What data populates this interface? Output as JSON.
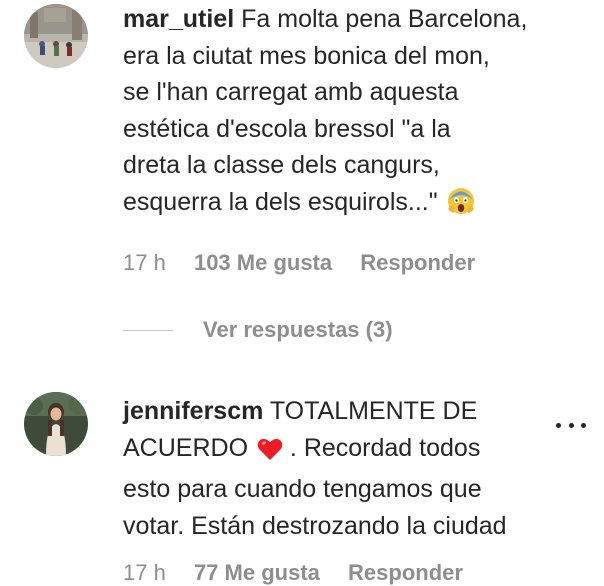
{
  "comments": [
    {
      "username": "mar_utiel",
      "lines": [
        "Fa molta pena Barcelona,",
        "era la ciutat mes bonica del mon,",
        "se l'han carregat amb aquesta",
        "estética d'escola bressol \"a la",
        "dreta la classe dels cangurs,",
        "esquerra la dels esquirols...\""
      ],
      "emoji": "screaming-face-emoji",
      "time": "17 h",
      "likes": "103 Me gusta",
      "reply": "Responder",
      "view_replies": "Ver respuestas (3)"
    },
    {
      "username": "jenniferscm",
      "lines": [
        "TOTALMENTE DE",
        "ACUERDO",
        ". Recordad todos",
        "esto para cuando tengamos que",
        "votar. Están destrozando la ciudad"
      ],
      "emoji": "red-heart-emoji",
      "time": "17 h",
      "likes": "77 Me gusta",
      "reply": "Responder"
    }
  ],
  "icons": {
    "more": "more-options-icon"
  },
  "colors": {
    "text": "#262626",
    "secondary": "#8e8e8e",
    "divider": "#c7c7c7",
    "heart": "#ed1c24"
  }
}
